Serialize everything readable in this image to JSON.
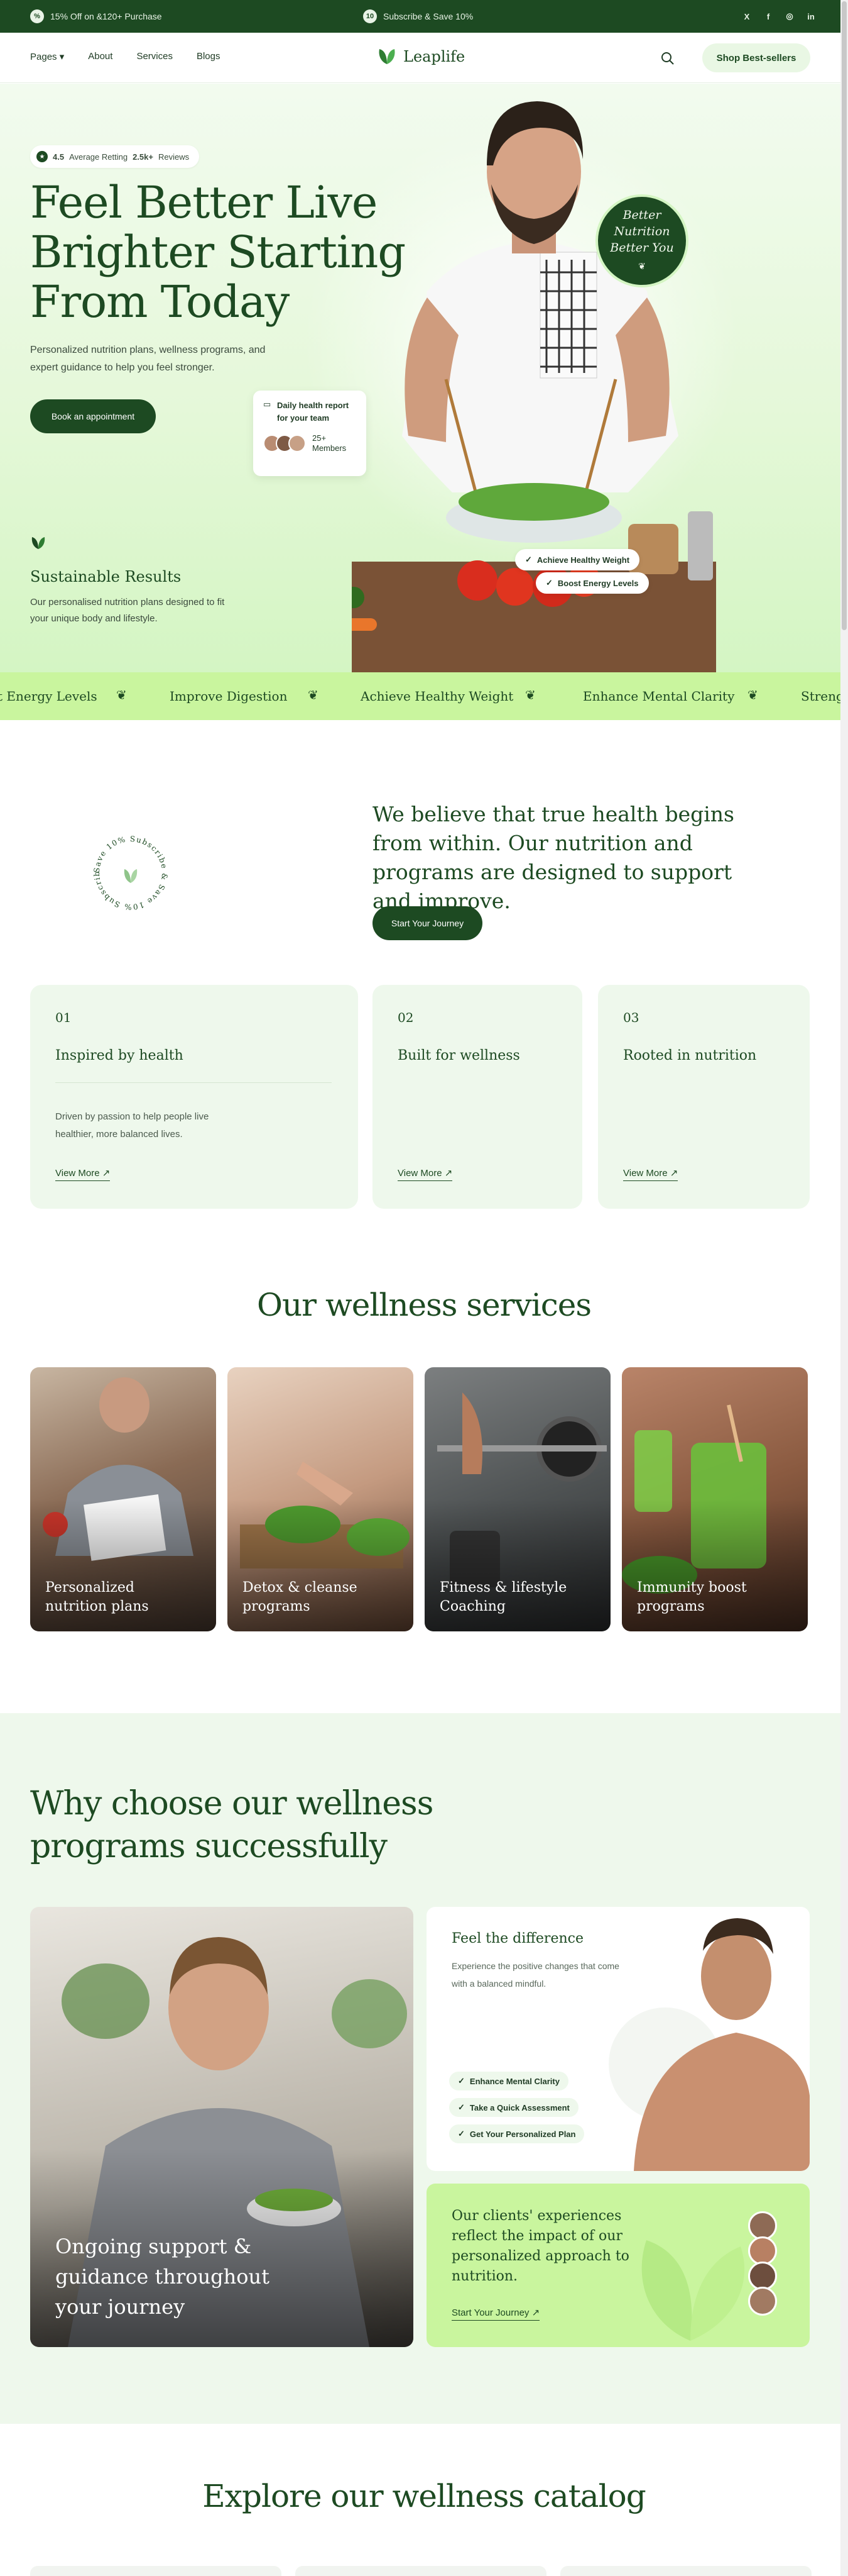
{
  "promo": {
    "left_badge": "%",
    "left_text": "15% Off on &120+ Purchase",
    "center_badge": "10",
    "center_text": "Subscribe & Save 10%",
    "social": [
      "X",
      "f",
      "◎",
      "in"
    ]
  },
  "nav": {
    "pages": "Pages ▾",
    "about": "About",
    "services": "Services",
    "blogs": "Blogs",
    "brand": "Leaplife",
    "shop": "Shop Best-sellers"
  },
  "hero": {
    "rating_value": "4.5",
    "rating_label": "Average Retting",
    "reviews_count": "2.5k+",
    "reviews_label": "Reviews",
    "title": "Feel Better Live Brighter Starting From Today",
    "subtitle": "Personalized nutrition plans, wellness programs, and expert guidance to help you feel stronger.",
    "cta": "Book an appointment",
    "results_title": "Sustainable Results",
    "results_text": "Our personalised nutrition plans designed to fit your unique body and lifestyle.",
    "round_badge": [
      "Better",
      "Nutrition",
      "Better You"
    ],
    "health_card_title": "Daily health report for your team",
    "members_count": "25+",
    "members_label": "Members",
    "chip_weight": "Achieve Healthy Weight",
    "chip_energy": "Boost Energy Levels"
  },
  "marquee": [
    "t Energy Levels",
    "Improve Digestion",
    "Achieve Healthy Weight",
    "Enhance Mental Clarity",
    "Streng"
  ],
  "belief": {
    "stamp_text": "Save 10% Subscribe & Save 10% Subscribe & ",
    "text": "We believe that true health begins from within. Our nutrition and programs are designed to support and improve.",
    "cta": "Start Your Journey"
  },
  "features": [
    {
      "num": "01",
      "title": "Inspired by health",
      "desc": "Driven by passion to help people live healthier, more balanced lives.",
      "more": "View More ↗"
    },
    {
      "num": "02",
      "title": "Built for wellness",
      "desc": "",
      "more": "View More ↗"
    },
    {
      "num": "03",
      "title": "Rooted in nutrition",
      "desc": "",
      "more": "View More ↗"
    }
  ],
  "services": {
    "title": "Our wellness services",
    "items": [
      "Personalized nutrition plans",
      "Detox & cleanse programs",
      "Fitness & lifestyle Coaching",
      "Immunity boost programs"
    ]
  },
  "why": {
    "title": "Why choose our wellness programs successfully",
    "big_label": "Ongoing support & guidance throughout your journey",
    "feel_title": "Feel the difference",
    "feel_desc": "Experience the positive changes that come with a balanced mindful.",
    "chips": [
      "Enhance Mental Clarity",
      "Take a Quick Assessment",
      "Get Your Personalized Plan"
    ],
    "exp_text": "Our clients' experiences reflect the impact of our personalized approach to nutrition.",
    "exp_link": "Start Your Journey ↗"
  },
  "catalog": {
    "title": "Explore our wellness catalog"
  },
  "colors": {
    "brand_dark": "#1d4a22",
    "accent_lime": "#c9f59e",
    "soft_green": "#eef8ec"
  }
}
